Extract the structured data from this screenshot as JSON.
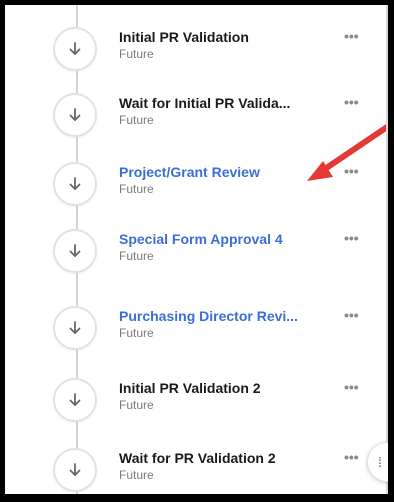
{
  "steps": [
    {
      "title": "Initial PR Validation",
      "status": "Future",
      "link": false
    },
    {
      "title": "Wait for Initial PR Valida...",
      "status": "Future",
      "link": false
    },
    {
      "title": "Project/Grant Review",
      "status": "Future",
      "link": true
    },
    {
      "title": "Special Form Approval 4",
      "status": "Future",
      "link": true
    },
    {
      "title": "Purchasing Director Revi...",
      "status": "Future",
      "link": true
    },
    {
      "title": "Initial PR Validation 2",
      "status": "Future",
      "link": false
    },
    {
      "title": "Wait for PR Validation 2",
      "status": "Future",
      "link": false
    }
  ],
  "more_glyph": "•••",
  "step_icon": "arrow-down-icon",
  "colors": {
    "link": "#3b6fd6",
    "annotation_arrow": "#e53935"
  }
}
